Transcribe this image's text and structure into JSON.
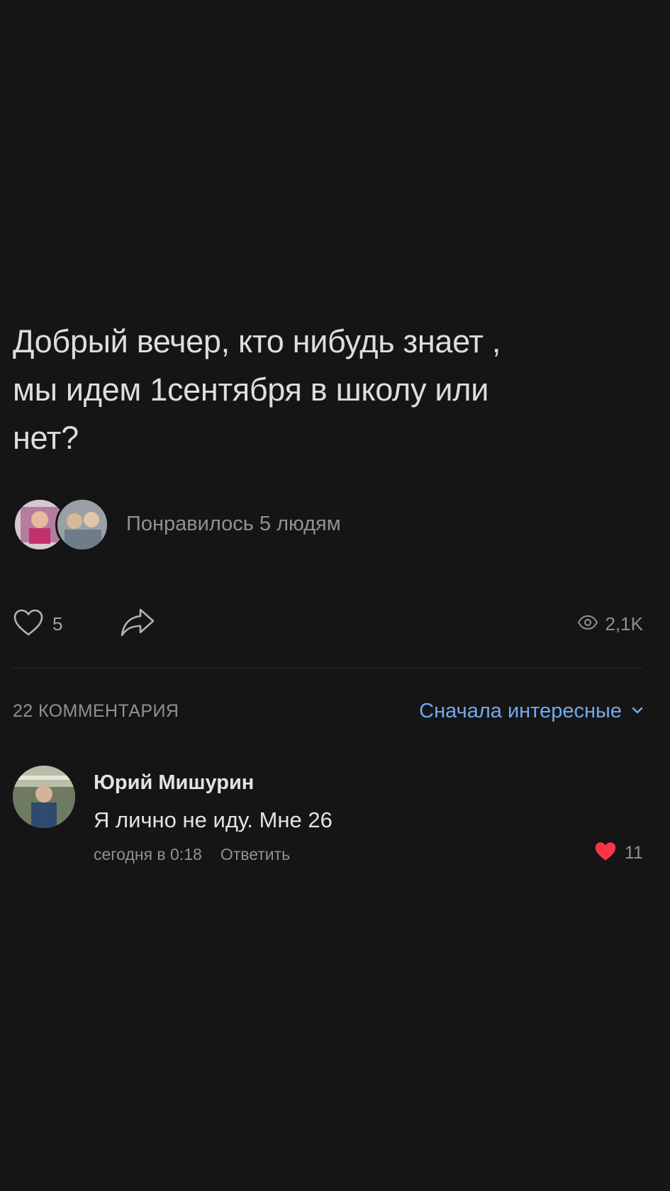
{
  "post": {
    "text": "Добрый вечер, кто нибудь знает ,\nмы идем 1сентября в школу или\nнет?"
  },
  "likes_summary": {
    "text": "Понравилось 5 людям"
  },
  "actions": {
    "like_count": "5",
    "views_count": "2,1K"
  },
  "comments": {
    "count_label": "22 КОММЕНТАРИЯ",
    "sort_label": "Сначала интересные",
    "items": [
      {
        "author": "Юрий Мишурин",
        "text": "Я лично не иду. Мне 26",
        "time": "сегодня в 0:18",
        "reply_label": "Ответить",
        "like_count": "11"
      }
    ]
  },
  "colors": {
    "background": "#151516",
    "accent": "#71aaeb",
    "like_red": "#ff3347",
    "muted": "#8e9195"
  }
}
